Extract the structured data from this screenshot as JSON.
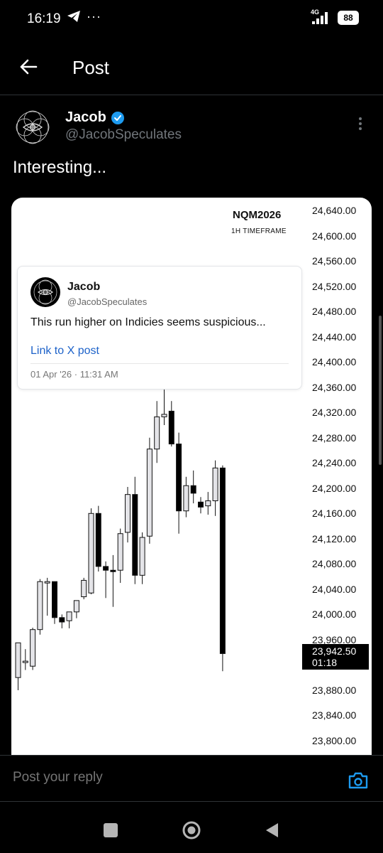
{
  "status": {
    "time": "16:19",
    "network": "4G",
    "battery": "88"
  },
  "header": {
    "title": "Post"
  },
  "post": {
    "author_name": "Jacob",
    "author_handle": "@JacobSpeculates",
    "text": "Interesting..."
  },
  "quote": {
    "author_name": "Jacob",
    "author_handle": "@JacobSpeculates",
    "text": "This run higher on Indicies seems suspicious...",
    "link": "Link to X post",
    "timestamp": "01 Apr '26 · 11:31 AM"
  },
  "reply": {
    "placeholder": "Post your reply"
  },
  "chart_data": {
    "type": "candlestick",
    "title": "NQM2026",
    "subtitle": "1H TIMEFRAME",
    "ylim": [
      23800,
      24640
    ],
    "y_ticks": [
      "24,640.00",
      "24,600.00",
      "24,560.00",
      "24,520.00",
      "24,480.00",
      "24,440.00",
      "24,400.00",
      "24,360.00",
      "24,320.00",
      "24,280.00",
      "24,240.00",
      "24,200.00",
      "24,160.00",
      "24,120.00",
      "24,080.00",
      "23,960.00",
      "24,040.00",
      "24,000.00",
      "23,880.00",
      "23,840.00",
      "23,800.00"
    ],
    "y_tick_values": [
      24640,
      24600,
      24560,
      24520,
      24480,
      24440,
      24400,
      24360,
      24320,
      24280,
      24240,
      24200,
      24160,
      24120,
      24080,
      23960,
      24040,
      24000,
      23880,
      23840,
      23800
    ],
    "current_price": "23,942.50",
    "countdown": "01:18",
    "candles": [
      {
        "o": 23900,
        "h": 23955,
        "l": 23880,
        "c": 23955
      },
      {
        "o": 23926,
        "h": 23945,
        "l": 23912,
        "c": 23926
      },
      {
        "o": 23918,
        "h": 23979,
        "l": 23912,
        "c": 23976
      },
      {
        "o": 23976,
        "h": 24056,
        "l": 23968,
        "c": 24052
      },
      {
        "o": 24052,
        "h": 24058,
        "l": 23998,
        "c": 24052
      },
      {
        "o": 24052,
        "h": 24052,
        "l": 23985,
        "c": 23995
      },
      {
        "o": 23995,
        "h": 24000,
        "l": 23978,
        "c": 23988
      },
      {
        "o": 23990,
        "h": 24000,
        "l": 23978,
        "c": 24004
      },
      {
        "o": 24004,
        "h": 24022,
        "l": 23994,
        "c": 24022
      },
      {
        "o": 24028,
        "h": 24058,
        "l": 24024,
        "c": 24054
      },
      {
        "o": 24034,
        "h": 24168,
        "l": 24032,
        "c": 24160
      },
      {
        "o": 24160,
        "h": 24172,
        "l": 24068,
        "c": 24076
      },
      {
        "o": 24076,
        "h": 24084,
        "l": 24026,
        "c": 24070
      },
      {
        "o": 24070,
        "h": 24094,
        "l": 24012,
        "c": 24068
      },
      {
        "o": 24070,
        "h": 24136,
        "l": 24050,
        "c": 24128
      },
      {
        "o": 24130,
        "h": 24202,
        "l": 24114,
        "c": 24190
      },
      {
        "o": 24190,
        "h": 24218,
        "l": 24048,
        "c": 24062
      },
      {
        "o": 24062,
        "h": 24130,
        "l": 24048,
        "c": 24122
      },
      {
        "o": 24124,
        "h": 24280,
        "l": 24112,
        "c": 24262
      },
      {
        "o": 24262,
        "h": 24338,
        "l": 24240,
        "c": 24313
      },
      {
        "o": 24313,
        "h": 24362,
        "l": 24300,
        "c": 24317
      },
      {
        "o": 24322,
        "h": 24338,
        "l": 24266,
        "c": 24270
      },
      {
        "o": 24270,
        "h": 24288,
        "l": 24128,
        "c": 24164
      },
      {
        "o": 24164,
        "h": 24218,
        "l": 24154,
        "c": 24204
      },
      {
        "o": 24204,
        "h": 24228,
        "l": 24176,
        "c": 24192
      },
      {
        "o": 24178,
        "h": 24186,
        "l": 24160,
        "c": 24170
      },
      {
        "o": 24172,
        "h": 24194,
        "l": 24158,
        "c": 24180
      },
      {
        "o": 24180,
        "h": 24244,
        "l": 24156,
        "c": 24232
      },
      {
        "o": 24232,
        "h": 24236,
        "l": 23910,
        "c": 23938
      }
    ]
  }
}
